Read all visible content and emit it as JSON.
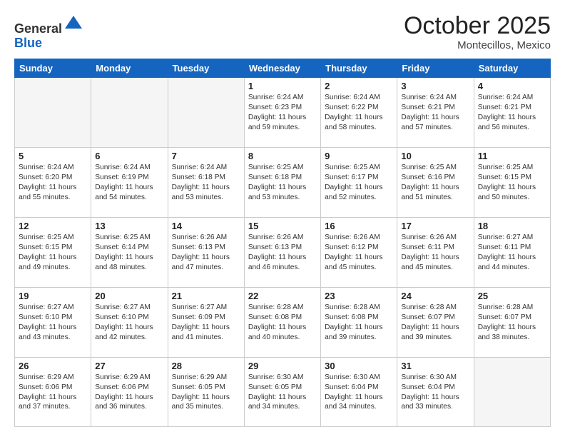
{
  "logo": {
    "general": "General",
    "blue": "Blue"
  },
  "header": {
    "month": "October 2025",
    "location": "Montecillos, Mexico"
  },
  "days_of_week": [
    "Sunday",
    "Monday",
    "Tuesday",
    "Wednesday",
    "Thursday",
    "Friday",
    "Saturday"
  ],
  "weeks": [
    [
      {
        "day": "",
        "sunrise": "",
        "sunset": "",
        "daylight": "",
        "empty": true
      },
      {
        "day": "",
        "sunrise": "",
        "sunset": "",
        "daylight": "",
        "empty": true
      },
      {
        "day": "",
        "sunrise": "",
        "sunset": "",
        "daylight": "",
        "empty": true
      },
      {
        "day": "1",
        "sunrise": "Sunrise: 6:24 AM",
        "sunset": "Sunset: 6:23 PM",
        "daylight": "Daylight: 11 hours and 59 minutes."
      },
      {
        "day": "2",
        "sunrise": "Sunrise: 6:24 AM",
        "sunset": "Sunset: 6:22 PM",
        "daylight": "Daylight: 11 hours and 58 minutes."
      },
      {
        "day": "3",
        "sunrise": "Sunrise: 6:24 AM",
        "sunset": "Sunset: 6:21 PM",
        "daylight": "Daylight: 11 hours and 57 minutes."
      },
      {
        "day": "4",
        "sunrise": "Sunrise: 6:24 AM",
        "sunset": "Sunset: 6:21 PM",
        "daylight": "Daylight: 11 hours and 56 minutes."
      }
    ],
    [
      {
        "day": "5",
        "sunrise": "Sunrise: 6:24 AM",
        "sunset": "Sunset: 6:20 PM",
        "daylight": "Daylight: 11 hours and 55 minutes."
      },
      {
        "day": "6",
        "sunrise": "Sunrise: 6:24 AM",
        "sunset": "Sunset: 6:19 PM",
        "daylight": "Daylight: 11 hours and 54 minutes."
      },
      {
        "day": "7",
        "sunrise": "Sunrise: 6:24 AM",
        "sunset": "Sunset: 6:18 PM",
        "daylight": "Daylight: 11 hours and 53 minutes."
      },
      {
        "day": "8",
        "sunrise": "Sunrise: 6:25 AM",
        "sunset": "Sunset: 6:18 PM",
        "daylight": "Daylight: 11 hours and 53 minutes."
      },
      {
        "day": "9",
        "sunrise": "Sunrise: 6:25 AM",
        "sunset": "Sunset: 6:17 PM",
        "daylight": "Daylight: 11 hours and 52 minutes."
      },
      {
        "day": "10",
        "sunrise": "Sunrise: 6:25 AM",
        "sunset": "Sunset: 6:16 PM",
        "daylight": "Daylight: 11 hours and 51 minutes."
      },
      {
        "day": "11",
        "sunrise": "Sunrise: 6:25 AM",
        "sunset": "Sunset: 6:15 PM",
        "daylight": "Daylight: 11 hours and 50 minutes."
      }
    ],
    [
      {
        "day": "12",
        "sunrise": "Sunrise: 6:25 AM",
        "sunset": "Sunset: 6:15 PM",
        "daylight": "Daylight: 11 hours and 49 minutes."
      },
      {
        "day": "13",
        "sunrise": "Sunrise: 6:25 AM",
        "sunset": "Sunset: 6:14 PM",
        "daylight": "Daylight: 11 hours and 48 minutes."
      },
      {
        "day": "14",
        "sunrise": "Sunrise: 6:26 AM",
        "sunset": "Sunset: 6:13 PM",
        "daylight": "Daylight: 11 hours and 47 minutes."
      },
      {
        "day": "15",
        "sunrise": "Sunrise: 6:26 AM",
        "sunset": "Sunset: 6:13 PM",
        "daylight": "Daylight: 11 hours and 46 minutes."
      },
      {
        "day": "16",
        "sunrise": "Sunrise: 6:26 AM",
        "sunset": "Sunset: 6:12 PM",
        "daylight": "Daylight: 11 hours and 45 minutes."
      },
      {
        "day": "17",
        "sunrise": "Sunrise: 6:26 AM",
        "sunset": "Sunset: 6:11 PM",
        "daylight": "Daylight: 11 hours and 45 minutes."
      },
      {
        "day": "18",
        "sunrise": "Sunrise: 6:27 AM",
        "sunset": "Sunset: 6:11 PM",
        "daylight": "Daylight: 11 hours and 44 minutes."
      }
    ],
    [
      {
        "day": "19",
        "sunrise": "Sunrise: 6:27 AM",
        "sunset": "Sunset: 6:10 PM",
        "daylight": "Daylight: 11 hours and 43 minutes."
      },
      {
        "day": "20",
        "sunrise": "Sunrise: 6:27 AM",
        "sunset": "Sunset: 6:10 PM",
        "daylight": "Daylight: 11 hours and 42 minutes."
      },
      {
        "day": "21",
        "sunrise": "Sunrise: 6:27 AM",
        "sunset": "Sunset: 6:09 PM",
        "daylight": "Daylight: 11 hours and 41 minutes."
      },
      {
        "day": "22",
        "sunrise": "Sunrise: 6:28 AM",
        "sunset": "Sunset: 6:08 PM",
        "daylight": "Daylight: 11 hours and 40 minutes."
      },
      {
        "day": "23",
        "sunrise": "Sunrise: 6:28 AM",
        "sunset": "Sunset: 6:08 PM",
        "daylight": "Daylight: 11 hours and 39 minutes."
      },
      {
        "day": "24",
        "sunrise": "Sunrise: 6:28 AM",
        "sunset": "Sunset: 6:07 PM",
        "daylight": "Daylight: 11 hours and 39 minutes."
      },
      {
        "day": "25",
        "sunrise": "Sunrise: 6:28 AM",
        "sunset": "Sunset: 6:07 PM",
        "daylight": "Daylight: 11 hours and 38 minutes."
      }
    ],
    [
      {
        "day": "26",
        "sunrise": "Sunrise: 6:29 AM",
        "sunset": "Sunset: 6:06 PM",
        "daylight": "Daylight: 11 hours and 37 minutes."
      },
      {
        "day": "27",
        "sunrise": "Sunrise: 6:29 AM",
        "sunset": "Sunset: 6:06 PM",
        "daylight": "Daylight: 11 hours and 36 minutes."
      },
      {
        "day": "28",
        "sunrise": "Sunrise: 6:29 AM",
        "sunset": "Sunset: 6:05 PM",
        "daylight": "Daylight: 11 hours and 35 minutes."
      },
      {
        "day": "29",
        "sunrise": "Sunrise: 6:30 AM",
        "sunset": "Sunset: 6:05 PM",
        "daylight": "Daylight: 11 hours and 34 minutes."
      },
      {
        "day": "30",
        "sunrise": "Sunrise: 6:30 AM",
        "sunset": "Sunset: 6:04 PM",
        "daylight": "Daylight: 11 hours and 34 minutes."
      },
      {
        "day": "31",
        "sunrise": "Sunrise: 6:30 AM",
        "sunset": "Sunset: 6:04 PM",
        "daylight": "Daylight: 11 hours and 33 minutes."
      },
      {
        "day": "",
        "sunrise": "",
        "sunset": "",
        "daylight": "",
        "empty": true
      }
    ]
  ]
}
